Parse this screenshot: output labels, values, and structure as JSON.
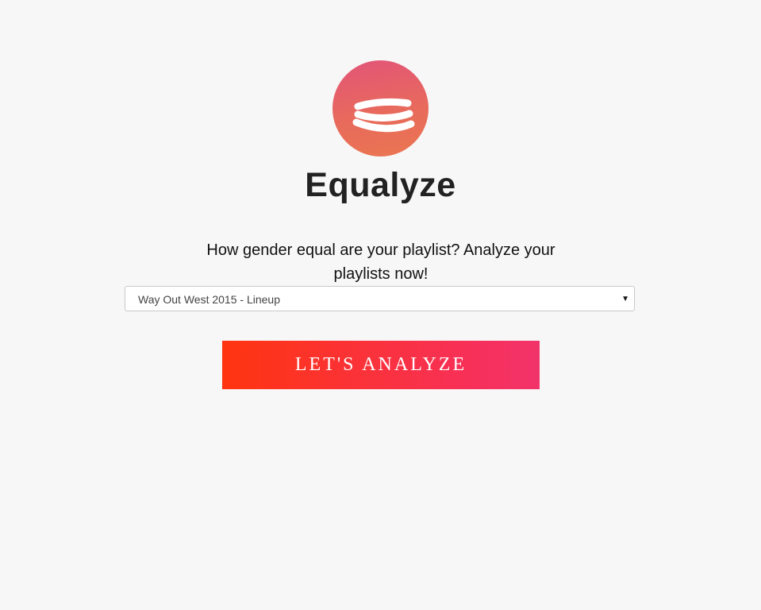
{
  "app": {
    "title": "Equalyze",
    "tagline": "How gender equal are your playlist? Analyze your playlists now!",
    "logo_icon": "equalizer-waves-logo"
  },
  "playlist_select": {
    "selected": "Way Out West 2015 - Lineup"
  },
  "analyze_button": {
    "label": "LET'S ANALYZE"
  },
  "colors": {
    "background": "#f7f7f7",
    "logo_top": "#e25478",
    "logo_bottom": "#ea7651",
    "button_start": "#ff3410",
    "button_end": "#f2336a",
    "title_text": "#222222"
  }
}
